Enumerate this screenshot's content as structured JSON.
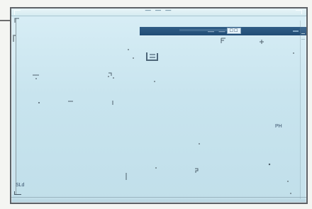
{
  "window": {
    "title": "— — —",
    "toolbar": {
      "label": "— —",
      "button_label": "☐☐"
    },
    "labels": {
      "left_bottom": "SLd",
      "right_mid": "PH",
      "center_marker": "⊟"
    }
  },
  "icons": {
    "top_left": "corner-icon",
    "tool_arrow": "arrow-icon",
    "plus": "plus-icon",
    "center_box": "box-icon",
    "left_slash": "slash-icon",
    "left_square": "square-icon",
    "lower_hook": "hook-icon",
    "right_dot": "dot-icon"
  },
  "colors": {
    "window_bg": "#c8e4ee",
    "toolbar_bg": "#204c75",
    "text": "#38506b",
    "border": "#5d6267"
  }
}
